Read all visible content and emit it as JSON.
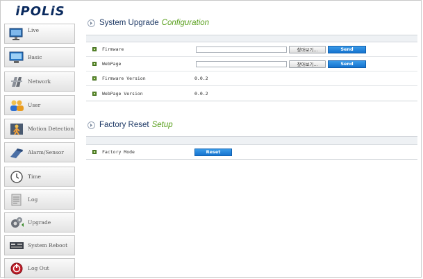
{
  "sidebar": {
    "logo": "iPOLiS",
    "items": [
      {
        "label": "Live",
        "icon": "live-monitor-icon"
      },
      {
        "label": "Basic",
        "icon": "basic-monitor-icon"
      },
      {
        "label": "Network",
        "icon": "network-icon"
      },
      {
        "label": "User",
        "icon": "user-icon"
      },
      {
        "label": "Motion Detection",
        "icon": "motion-detection-icon"
      },
      {
        "label": "Alarm/Sensor",
        "icon": "alarm-sensor-icon"
      },
      {
        "label": "Time",
        "icon": "clock-icon"
      },
      {
        "label": "Log",
        "icon": "log-icon"
      },
      {
        "label": "Upgrade",
        "icon": "upgrade-icon"
      },
      {
        "label": "System Reboot",
        "icon": "system-reboot-icon"
      },
      {
        "label": "Log Out",
        "icon": "logout-icon"
      }
    ]
  },
  "upgrade": {
    "title": "System Upgrade",
    "title_accent": "Configuration",
    "firmware_label": "Firmware",
    "firmware_value": "",
    "webpage_label": "WebPage",
    "webpage_value": "",
    "browse_label": "찾아보기...",
    "send_label": "Send",
    "firmware_version_label": "Firmware Version",
    "firmware_version": "0.0.2",
    "webpage_version_label": "WebPage Version",
    "webpage_version": "0.0.2"
  },
  "reset": {
    "title": "Factory Reset",
    "title_accent": "Setup",
    "factory_mode_label": "Factory Mode",
    "reset_label": "Reset"
  },
  "colors": {
    "accent_green": "#5aa01e",
    "button_blue": "#1573cf",
    "title_navy": "#1f3a66"
  }
}
